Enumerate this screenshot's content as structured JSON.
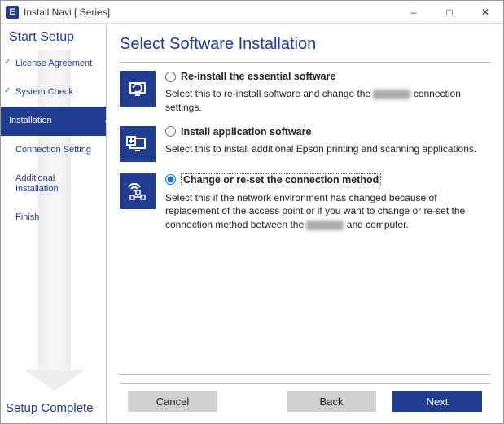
{
  "window": {
    "app_icon_letter": "E",
    "title": "Install Navi [        Series]"
  },
  "sidebar": {
    "head": "Start Setup",
    "foot": "Setup Complete",
    "steps": [
      {
        "label": "License Agreement",
        "done": true,
        "current": false
      },
      {
        "label": "System Check",
        "done": true,
        "current": false
      },
      {
        "label": "Installation",
        "done": false,
        "current": true
      },
      {
        "label": "Connection Setting",
        "done": false,
        "current": false
      },
      {
        "label": "Additional\nInstallation",
        "done": false,
        "current": false
      },
      {
        "label": "Finish",
        "done": false,
        "current": false
      }
    ]
  },
  "main": {
    "title": "Select Software Installation",
    "options": [
      {
        "id": "reinstall",
        "title": "Re-install the essential software",
        "desc_pre": "Select this to re-install software and change the ",
        "mask": true,
        "desc_post": " connection settings.",
        "selected": false
      },
      {
        "id": "install-app",
        "title": "Install application software",
        "desc_pre": "Select this to install additional Epson printing and scanning applications.",
        "mask": false,
        "desc_post": "",
        "selected": false
      },
      {
        "id": "change-conn",
        "title": "Change or re-set the connection method",
        "desc_pre": "Select this if the network environment has changed because of replacement of the access point or if you want to change or re-set the connection method between the ",
        "mask": true,
        "desc_post": " and computer.",
        "selected": true
      }
    ]
  },
  "footer": {
    "cancel": "Cancel",
    "back": "Back",
    "next": "Next"
  }
}
